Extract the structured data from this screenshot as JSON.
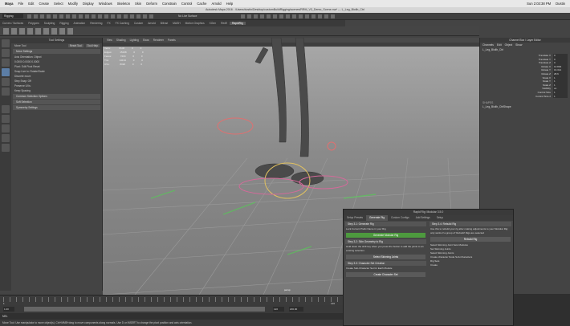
{
  "menubar": {
    "app": "Maya",
    "items": [
      "File",
      "Edit",
      "Create",
      "Select",
      "Modify",
      "Display",
      "Windows",
      "Skeleton",
      "Skin",
      "Deform",
      "Constrain",
      "Control",
      "Cache",
      "Arnold",
      "Help"
    ],
    "clock": "Sun 2:03:38 PM",
    "user": "Dustin"
  },
  "window_title": "Autodesk Maya 2016 - /Users/dustin/Desktop/customBuildRigging/scenes/RRM_V3_Demo_Scene.ma* --- L_Leg_Biolib_Ctrl",
  "toolbar": {
    "mode": "Rigging",
    "surface_label": "No Live Surface"
  },
  "shelf_tabs": [
    "Curves / Surfaces",
    "Polygons",
    "Sculpting",
    "Rigging",
    "Animation",
    "Rendering",
    "FX",
    "FX Caching",
    "Custom",
    "Arnold",
    "Bifrost",
    "MASH",
    "Motion Graphics",
    "XGen",
    "Red9",
    "RapidRig"
  ],
  "shelf_active": "RapidRig",
  "tool_settings": {
    "title": "Tool Settings",
    "tool": "Move Tool",
    "reset": "Reset Tool",
    "help": "Tool Help",
    "sections": [
      "Move Settings",
      "Common Selection Options",
      "Soft Selection",
      "Symmetry Settings"
    ],
    "rows": [
      "Axis Orientation:  Object",
      "0.0000  0.0000  0.0000",
      "Pivot:  Edit Pivot  Reset",
      "Snap Live to: Rotate/Scale",
      "Discrete move",
      "Step Snap:  Off",
      "Preserve UVs:",
      "Keep Spacing"
    ]
  },
  "viewport": {
    "menu": [
      "View",
      "Shading",
      "Lighting",
      "Show",
      "Renderer",
      "Panels"
    ],
    "hud": [
      {
        "label": "Verts:",
        "a": "8146",
        "b": "0",
        "c": "0"
      },
      {
        "label": "Edges:",
        "a": "15168",
        "b": "0",
        "c": "0"
      },
      {
        "label": "Faces:",
        "a": "7204",
        "b": "0",
        "c": "0"
      },
      {
        "label": "Tris:",
        "a": "14134",
        "b": "0",
        "c": "0"
      },
      {
        "label": "UVs:",
        "a": "8320",
        "b": "0",
        "c": "0"
      }
    ],
    "camera": "persp"
  },
  "channel_box": {
    "title": "Channel Box / Layer Editor",
    "menu": [
      "Channels",
      "Edit",
      "Object",
      "Show"
    ],
    "node": "L_Leg_Biolib_Ctrl",
    "attrs": [
      {
        "name": "Translate X",
        "value": "0"
      },
      {
        "name": "Translate Y",
        "value": "0"
      },
      {
        "name": "Translate Z",
        "value": "0"
      },
      {
        "name": "Rotate X",
        "value": "10.894"
      },
      {
        "name": "Rotate Y",
        "value": "16.314"
      },
      {
        "name": "Rotate Z",
        "value": "28.6"
      },
      {
        "name": "Scale X",
        "value": "1"
      },
      {
        "name": "Scale Y",
        "value": "1"
      },
      {
        "name": "Scale Z",
        "value": "1"
      },
      {
        "name": "Visibility",
        "value": "on"
      },
      {
        "name": "Control Size",
        "value": "1"
      },
      {
        "name": "Control Size 2",
        "value": "1"
      }
    ],
    "shapes_label": "SHAPES",
    "shape": "L_Leg_Biolib_CtrlShape"
  },
  "timeline": {
    "start": "1",
    "end": "120",
    "range_start": "1.00",
    "range_end": "120",
    "playback_end": "200.00"
  },
  "command_line": "MEL",
  "help_line": "Move Tool: Use manipulator to move object(s). Ctrl+MMB+drag to move components along normals. Use D or INSERT to change the pivot position and axis orientation.",
  "rig_window": {
    "title": "Rapid Rig: Modular 3.5.0",
    "tabs": [
      "Setup Presets",
      "Generate Rig",
      "Custom Configs",
      "Add Settings",
      "Setup"
    ],
    "active_tab": "Generate Rig",
    "step1_title": "Step 3.1: Generate Rig",
    "step1_check": "Lock Current Prefix Name in your Rig",
    "generate_btn": "Generate Modular Rig",
    "step2_title": "Step 3.2: Skin Geometry to Rig",
    "step2_text": "Hold down the shift key when you press the button to add the joints to an existing selection.",
    "select_skin_btn": "Select Skinning Joints",
    "step3_title": "Step 3.3: Character Set Creation",
    "step3_check": "Create Sub-Character Set for Each Module",
    "create_set_btn": "Create Character Set",
    "right_title": "Step 3.4: Rebuild Rig",
    "right_text": "Use this to rebuild your rig after making adjustments to your Modular Rig: only works if a group of 'Rebuild' Rigs are selected",
    "rebuild_btn": "Rebuild Rig",
    "right_items": [
      "Select Skinning Joint Sets Modules",
      "Set Skinning Joints",
      "Select Skinning Joints"
    ],
    "right_checks": [
      "Rig Sets",
      "Create"
    ],
    "sub_text": "Create character Node Sub-Characters"
  }
}
